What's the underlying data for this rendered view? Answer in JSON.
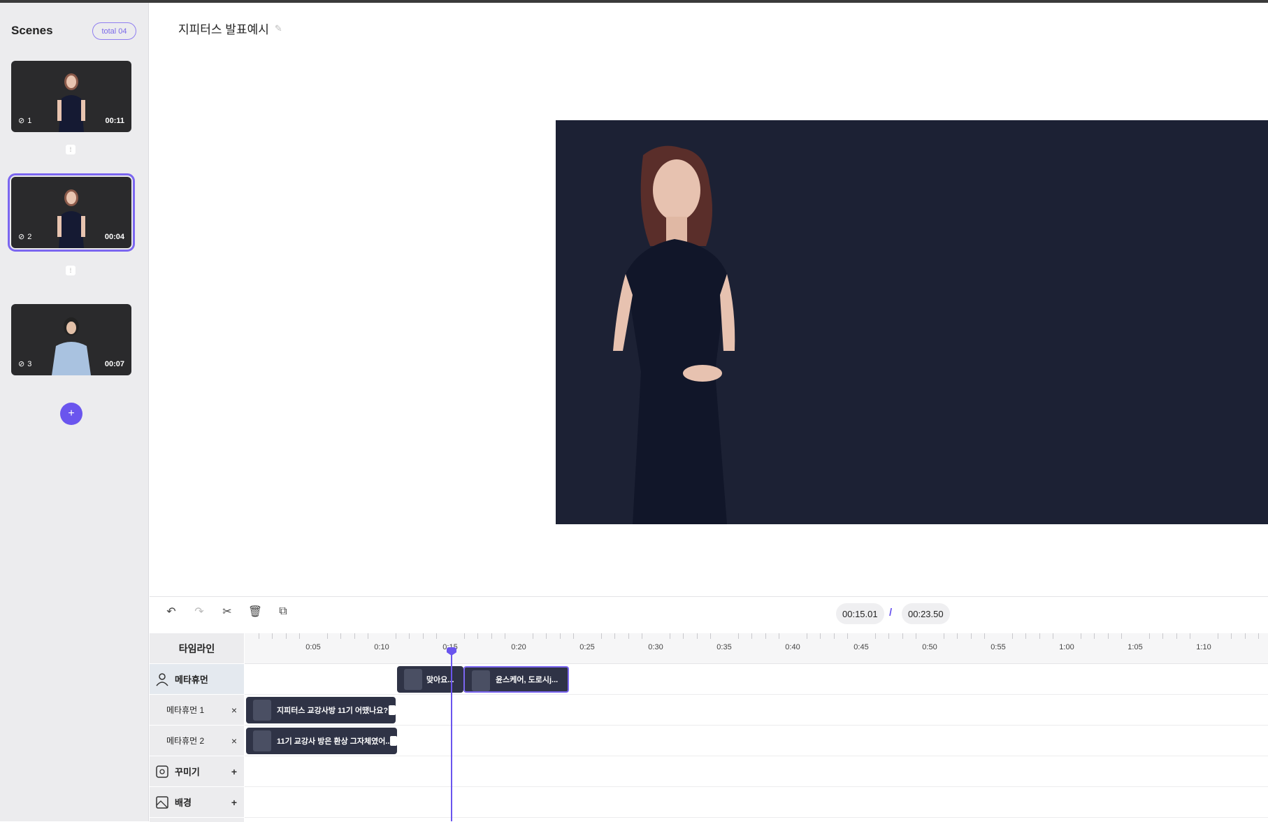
{
  "sidebar": {
    "title": "Scenes",
    "total": "total 04",
    "scenes": [
      {
        "num": "1",
        "duration": "00:11"
      },
      {
        "num": "2",
        "duration": "00:04"
      },
      {
        "num": "3",
        "duration": "00:07"
      }
    ],
    "add_label": "+"
  },
  "project": {
    "title": "지피터스 발표예시",
    "edit_icon": "pencil-icon"
  },
  "toolbar": {
    "icons": [
      "undo-icon",
      "redo-icon",
      "cut-icon",
      "delete-icon",
      "duplicate-icon"
    ],
    "current_time": "00:15.01",
    "separator": "/",
    "total_time": "00:23.50"
  },
  "timeline": {
    "header": "타임라인",
    "ruler_labels": [
      "0:05",
      "0:10",
      "0:15",
      "0:20",
      "0:25",
      "0:30",
      "0:35",
      "0:40",
      "0:45",
      "0:50",
      "0:55",
      "1:00",
      "1:05",
      "1:10"
    ],
    "tracks": [
      {
        "label": "메타휴먼",
        "action": ""
      },
      {
        "label": "메타휴먼 1",
        "action": "×"
      },
      {
        "label": "메타휴먼 2",
        "action": "×"
      },
      {
        "label": "꾸미기",
        "action": "+"
      },
      {
        "label": "배경",
        "action": "+"
      }
    ],
    "clips": {
      "main_a": "맞아요...",
      "main_b": "윤스케어, 도로시j...",
      "sub1": "지피터스 교강사방 11기 어땠나요?",
      "sub2": "11기 교강사 방은 환상 그자체였어..."
    },
    "playhead_time": "0:15"
  },
  "colors": {
    "accent": "#6a55ee",
    "preview_bg": "#1c2134",
    "clip_bg": "#2f3346"
  }
}
